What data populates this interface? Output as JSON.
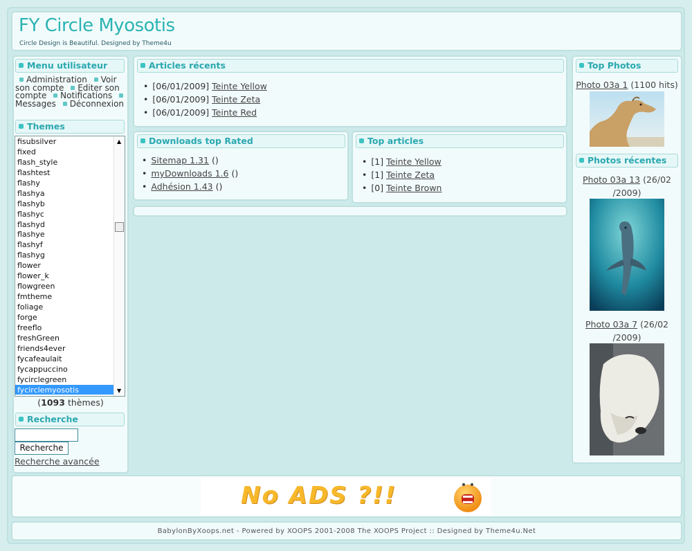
{
  "header": {
    "title": "FY Circle Myosotis",
    "slogan": "Circle Design is Beautiful. Designed by Theme4u"
  },
  "usermenu": {
    "title": "Menu utilisateur",
    "items": [
      "Administration",
      "Voir son compte",
      "Editer son compte",
      "Notifications",
      "Messages",
      "Déconnexion"
    ]
  },
  "themes": {
    "title": "Themes",
    "items": [
      "fisubsilver",
      "fixed",
      "flash_style",
      "flashtest",
      "flashy",
      "flashya",
      "flashyb",
      "flashyc",
      "flashyd",
      "flashye",
      "flashyf",
      "flashyg",
      "flower",
      "flower_k",
      "flowgreen",
      "fmtheme",
      "foliage",
      "forge",
      "freeflo",
      "freshGreen",
      "friends4ever",
      "fycafeaulait",
      "fycappuccino",
      "fycirclegreen",
      "fycirclemyosotis"
    ],
    "selected": "fycirclemyosotis",
    "count_number": "1093",
    "count_suffix": "thèmes"
  },
  "search": {
    "title": "Recherche",
    "input_value": "",
    "button_label": "Recherche",
    "advanced_link": "Recherche avancée"
  },
  "recent_articles": {
    "title": "Articles récents",
    "items": [
      {
        "date": "[06/01/2009]",
        "label": "Teinte Yellow"
      },
      {
        "date": "[06/01/2009]",
        "label": "Teinte Zeta"
      },
      {
        "date": "[06/01/2009]",
        "label": "Teinte Red"
      }
    ]
  },
  "downloads": {
    "title": "Downloads top Rated",
    "items": [
      {
        "label": "Sitemap 1.31",
        "suffix": "()"
      },
      {
        "label": "myDownloads 1.6",
        "suffix": "()"
      },
      {
        "label": "Adhésion 1.43",
        "suffix": "()"
      }
    ]
  },
  "top_articles": {
    "title": "Top articles",
    "items": [
      {
        "count": "[1]",
        "label": "Teinte Yellow"
      },
      {
        "count": "[1]",
        "label": "Teinte Zeta"
      },
      {
        "count": "[0]",
        "label": "Teinte Brown"
      }
    ]
  },
  "top_photos": {
    "title": "Top Photos",
    "caption_link": "Photo 03a 1",
    "caption_suffix": "(1100 hits)"
  },
  "recent_photos": {
    "title": "Photos récentes",
    "photos": [
      {
        "link": "Photo 03a 13",
        "suffix_line1": "(26/02",
        "suffix_line2": "/2009)"
      },
      {
        "link": "Photo 03a 7",
        "suffix_line1": "(26/02",
        "suffix_line2": "/2009)"
      }
    ]
  },
  "banner": {
    "text": "No ADS ?!!"
  },
  "footer": {
    "text": "BabylonByXoops.net - Powered by XOOPS 2001-2008 The XOOPS Project :: Designed by Theme4u.Net"
  },
  "colors": {
    "accent": "#2cb3b3",
    "background": "#d7eeee",
    "selection": "#3399ff"
  }
}
